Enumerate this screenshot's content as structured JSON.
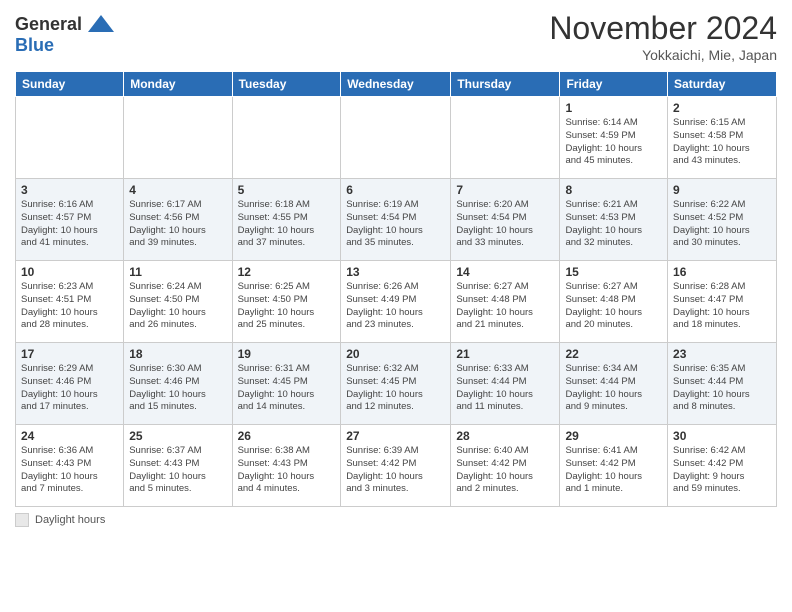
{
  "header": {
    "logo_line1": "General",
    "logo_line2": "Blue",
    "month_title": "November 2024",
    "location": "Yokkaichi, Mie, Japan"
  },
  "days_of_week": [
    "Sunday",
    "Monday",
    "Tuesday",
    "Wednesday",
    "Thursday",
    "Friday",
    "Saturday"
  ],
  "legend_label": "Daylight hours",
  "weeks": [
    [
      {
        "day": "",
        "info": ""
      },
      {
        "day": "",
        "info": ""
      },
      {
        "day": "",
        "info": ""
      },
      {
        "day": "",
        "info": ""
      },
      {
        "day": "",
        "info": ""
      },
      {
        "day": "1",
        "info": "Sunrise: 6:14 AM\nSunset: 4:59 PM\nDaylight: 10 hours\nand 45 minutes."
      },
      {
        "day": "2",
        "info": "Sunrise: 6:15 AM\nSunset: 4:58 PM\nDaylight: 10 hours\nand 43 minutes."
      }
    ],
    [
      {
        "day": "3",
        "info": "Sunrise: 6:16 AM\nSunset: 4:57 PM\nDaylight: 10 hours\nand 41 minutes."
      },
      {
        "day": "4",
        "info": "Sunrise: 6:17 AM\nSunset: 4:56 PM\nDaylight: 10 hours\nand 39 minutes."
      },
      {
        "day": "5",
        "info": "Sunrise: 6:18 AM\nSunset: 4:55 PM\nDaylight: 10 hours\nand 37 minutes."
      },
      {
        "day": "6",
        "info": "Sunrise: 6:19 AM\nSunset: 4:54 PM\nDaylight: 10 hours\nand 35 minutes."
      },
      {
        "day": "7",
        "info": "Sunrise: 6:20 AM\nSunset: 4:54 PM\nDaylight: 10 hours\nand 33 minutes."
      },
      {
        "day": "8",
        "info": "Sunrise: 6:21 AM\nSunset: 4:53 PM\nDaylight: 10 hours\nand 32 minutes."
      },
      {
        "day": "9",
        "info": "Sunrise: 6:22 AM\nSunset: 4:52 PM\nDaylight: 10 hours\nand 30 minutes."
      }
    ],
    [
      {
        "day": "10",
        "info": "Sunrise: 6:23 AM\nSunset: 4:51 PM\nDaylight: 10 hours\nand 28 minutes."
      },
      {
        "day": "11",
        "info": "Sunrise: 6:24 AM\nSunset: 4:50 PM\nDaylight: 10 hours\nand 26 minutes."
      },
      {
        "day": "12",
        "info": "Sunrise: 6:25 AM\nSunset: 4:50 PM\nDaylight: 10 hours\nand 25 minutes."
      },
      {
        "day": "13",
        "info": "Sunrise: 6:26 AM\nSunset: 4:49 PM\nDaylight: 10 hours\nand 23 minutes."
      },
      {
        "day": "14",
        "info": "Sunrise: 6:27 AM\nSunset: 4:48 PM\nDaylight: 10 hours\nand 21 minutes."
      },
      {
        "day": "15",
        "info": "Sunrise: 6:27 AM\nSunset: 4:48 PM\nDaylight: 10 hours\nand 20 minutes."
      },
      {
        "day": "16",
        "info": "Sunrise: 6:28 AM\nSunset: 4:47 PM\nDaylight: 10 hours\nand 18 minutes."
      }
    ],
    [
      {
        "day": "17",
        "info": "Sunrise: 6:29 AM\nSunset: 4:46 PM\nDaylight: 10 hours\nand 17 minutes."
      },
      {
        "day": "18",
        "info": "Sunrise: 6:30 AM\nSunset: 4:46 PM\nDaylight: 10 hours\nand 15 minutes."
      },
      {
        "day": "19",
        "info": "Sunrise: 6:31 AM\nSunset: 4:45 PM\nDaylight: 10 hours\nand 14 minutes."
      },
      {
        "day": "20",
        "info": "Sunrise: 6:32 AM\nSunset: 4:45 PM\nDaylight: 10 hours\nand 12 minutes."
      },
      {
        "day": "21",
        "info": "Sunrise: 6:33 AM\nSunset: 4:44 PM\nDaylight: 10 hours\nand 11 minutes."
      },
      {
        "day": "22",
        "info": "Sunrise: 6:34 AM\nSunset: 4:44 PM\nDaylight: 10 hours\nand 9 minutes."
      },
      {
        "day": "23",
        "info": "Sunrise: 6:35 AM\nSunset: 4:44 PM\nDaylight: 10 hours\nand 8 minutes."
      }
    ],
    [
      {
        "day": "24",
        "info": "Sunrise: 6:36 AM\nSunset: 4:43 PM\nDaylight: 10 hours\nand 7 minutes."
      },
      {
        "day": "25",
        "info": "Sunrise: 6:37 AM\nSunset: 4:43 PM\nDaylight: 10 hours\nand 5 minutes."
      },
      {
        "day": "26",
        "info": "Sunrise: 6:38 AM\nSunset: 4:43 PM\nDaylight: 10 hours\nand 4 minutes."
      },
      {
        "day": "27",
        "info": "Sunrise: 6:39 AM\nSunset: 4:42 PM\nDaylight: 10 hours\nand 3 minutes."
      },
      {
        "day": "28",
        "info": "Sunrise: 6:40 AM\nSunset: 4:42 PM\nDaylight: 10 hours\nand 2 minutes."
      },
      {
        "day": "29",
        "info": "Sunrise: 6:41 AM\nSunset: 4:42 PM\nDaylight: 10 hours\nand 1 minute."
      },
      {
        "day": "30",
        "info": "Sunrise: 6:42 AM\nSunset: 4:42 PM\nDaylight: 9 hours\nand 59 minutes."
      }
    ]
  ]
}
